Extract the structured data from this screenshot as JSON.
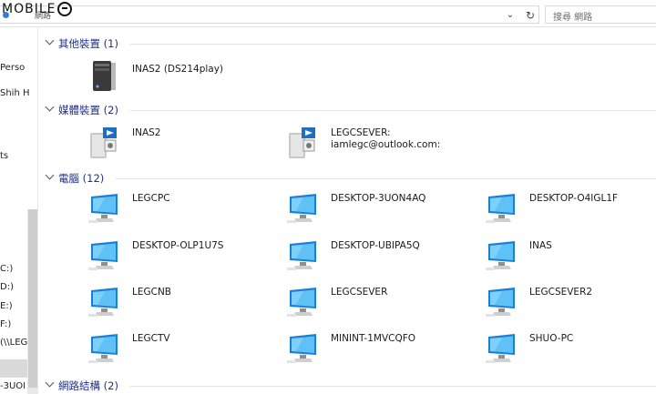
{
  "watermark": {
    "text": "MOBILE01"
  },
  "address_bar": {
    "path_text": "網路",
    "chevron": "chevron-down-icon",
    "refresh": "refresh-icon"
  },
  "search": {
    "placeholder": "搜尋 網路"
  },
  "nav": {
    "items": [
      {
        "label": "Perso"
      },
      {
        "label": "Shih H"
      },
      {
        "label": "ts"
      },
      {
        "label": "C:)"
      },
      {
        "label": "D:)"
      },
      {
        "label": "E:)"
      },
      {
        "label": "F:)"
      },
      {
        "label": "(\\\\LEG"
      },
      {
        "label": "-3UOI"
      }
    ]
  },
  "groups": [
    {
      "title": "其他裝置 (1)",
      "items": [
        {
          "label": "INAS2 (DS214play)",
          "icon": "nas-device-icon"
        }
      ]
    },
    {
      "title": "媒體裝置 (2)",
      "items": [
        {
          "label": "INAS2",
          "icon": "media-server-icon"
        },
        {
          "label": "LEGCSEVER:\niamlegc@outlook.com:",
          "icon": "media-server-icon"
        }
      ]
    },
    {
      "title": "電腦 (12)",
      "items": [
        {
          "label": "LEGCPC",
          "icon": "computer-icon"
        },
        {
          "label": "DESKTOP-3UON4AQ",
          "icon": "computer-icon"
        },
        {
          "label": "DESKTOP-O4IGL1F",
          "icon": "computer-icon"
        },
        {
          "label": "DESKTOP-OLP1U7S",
          "icon": "computer-icon"
        },
        {
          "label": "DESKTOP-UBIPA5Q",
          "icon": "computer-icon"
        },
        {
          "label": "INAS",
          "icon": "computer-icon"
        },
        {
          "label": "LEGCNB",
          "icon": "computer-icon"
        },
        {
          "label": "LEGCSEVER",
          "icon": "computer-icon"
        },
        {
          "label": "LEGCSEVER2",
          "icon": "computer-icon"
        },
        {
          "label": "LEGCTV",
          "icon": "computer-icon"
        },
        {
          "label": "MININT-1MVCQFO",
          "icon": "computer-icon"
        },
        {
          "label": "SHUO-PC",
          "icon": "computer-icon"
        }
      ]
    },
    {
      "title": "網路結構 (2)",
      "items": []
    }
  ]
}
